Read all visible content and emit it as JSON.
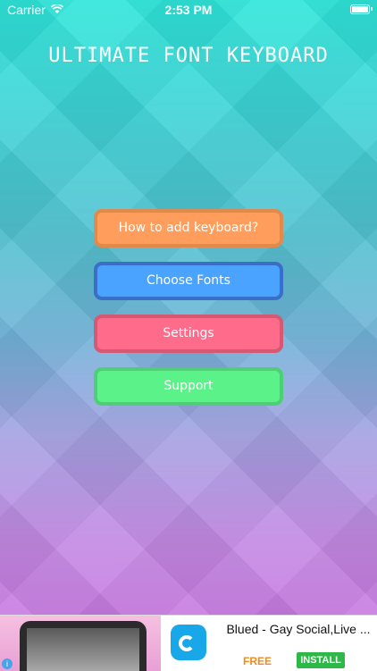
{
  "status_bar": {
    "carrier": "Carrier",
    "time": "2:53 PM"
  },
  "app": {
    "title": "ULTIMATE FONT KEYBOARD"
  },
  "menu": {
    "items": [
      {
        "label": "How to add keyboard?",
        "color": "#ff9d5c"
      },
      {
        "label": "Choose Fonts",
        "color": "#4aa3ff"
      },
      {
        "label": "Settings",
        "color": "#ff6b8a"
      },
      {
        "label": "Support",
        "color": "#5cf28a"
      }
    ]
  },
  "ad": {
    "title": "Blued - Gay Social,Live ...",
    "price": "FREE",
    "install_label": "INSTALL",
    "info_icon": "info-icon"
  }
}
